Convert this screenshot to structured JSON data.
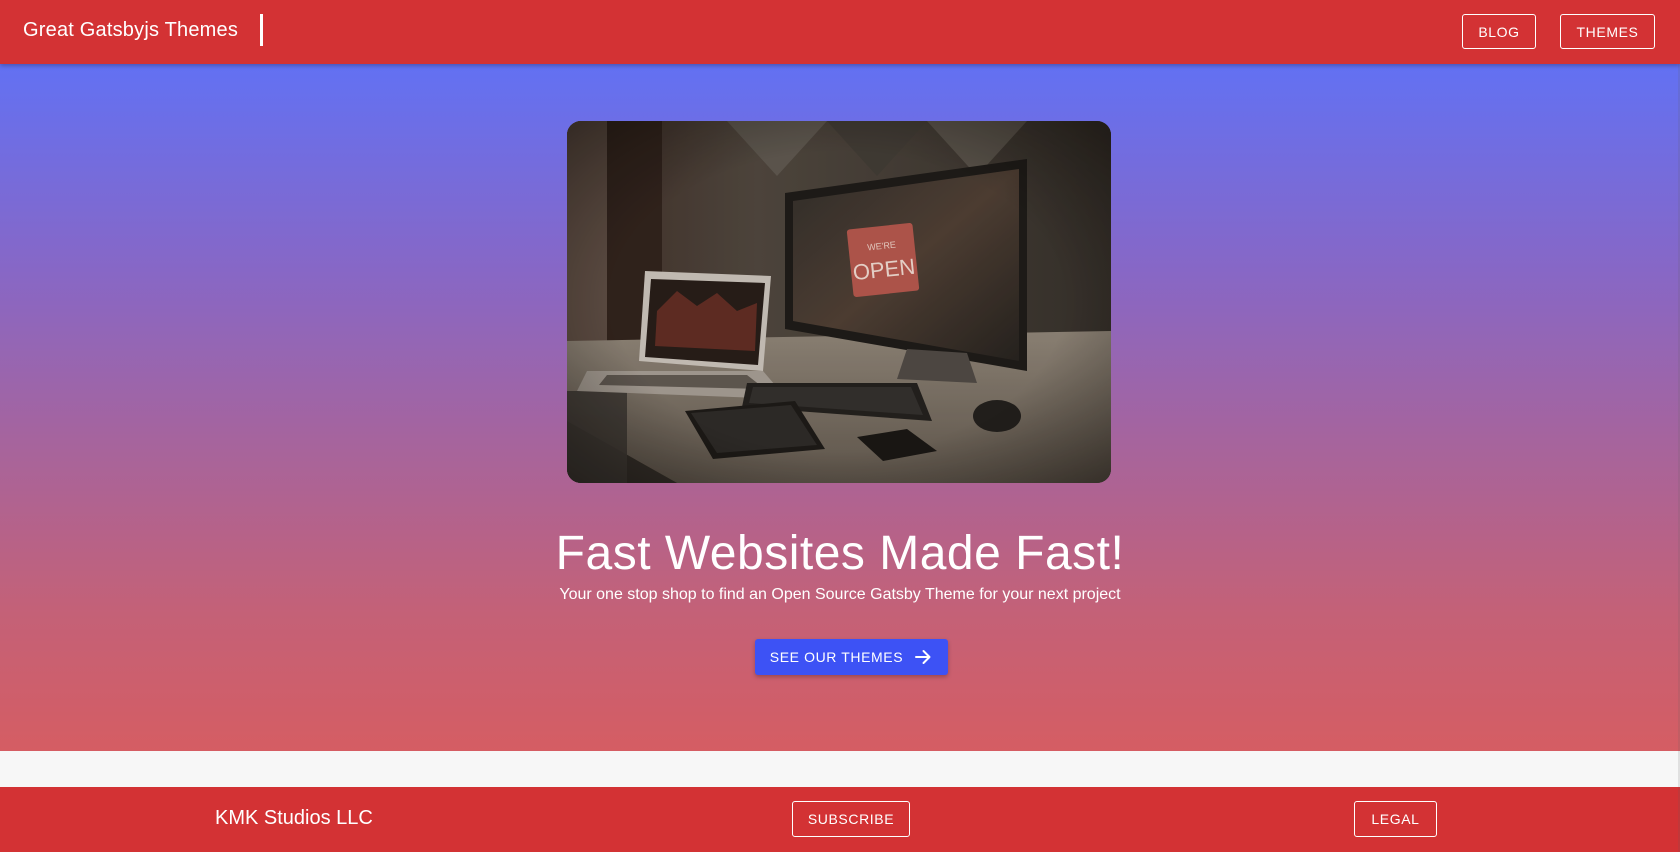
{
  "header": {
    "brand": "Great Gatsbyjs Themes",
    "nav": [
      {
        "label": "BLOG"
      },
      {
        "label": "THEMES"
      }
    ]
  },
  "hero": {
    "image_alt": "Desk with laptop, monitor showing We're Open sign, keyboard, tablet and phone",
    "image_sign_text": "WE'RE OPEN",
    "title": "Fast Websites Made Fast!",
    "subtitle": "Your one stop shop to find an Open Source Gatsby Theme for your next project",
    "cta_label": "SEE OUR THEMES",
    "cta_icon": "arrow-right-icon"
  },
  "footer": {
    "brand": "KMK Studios LLC",
    "subscribe_label": "SUBSCRIBE",
    "legal_label": "LEGAL"
  },
  "colors": {
    "primary": "#d33234",
    "accent": "#3d52f5",
    "gradient_top": "#6271f3",
    "gradient_bottom": "#d55d63"
  }
}
